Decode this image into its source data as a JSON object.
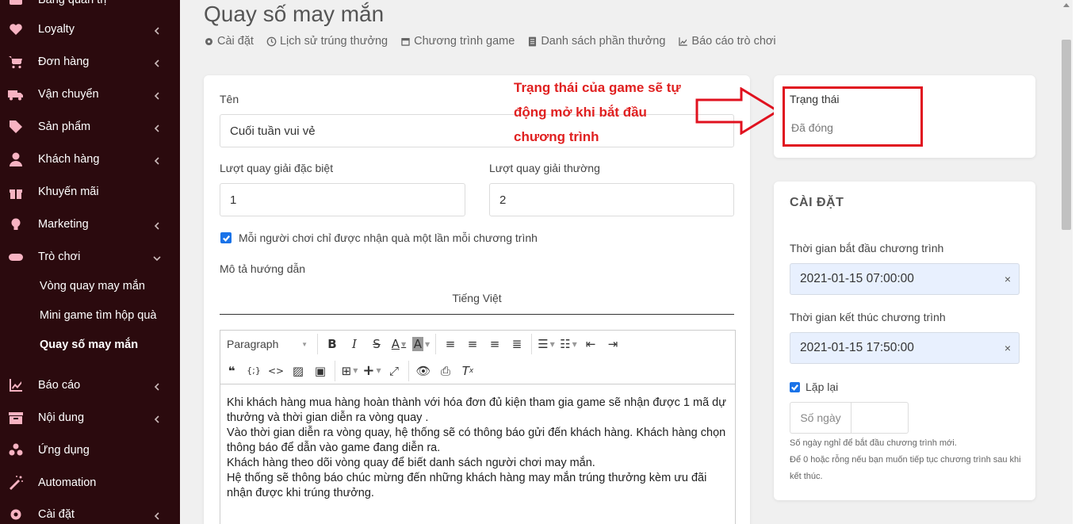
{
  "sidebar": {
    "items": [
      {
        "label": "Bảng quản trị",
        "icon": "dashboard-icon"
      },
      {
        "label": "Loyalty",
        "icon": "heart-icon"
      },
      {
        "label": "Đơn hàng",
        "icon": "cart-icon"
      },
      {
        "label": "Vận chuyển",
        "icon": "truck-icon"
      },
      {
        "label": "Sản phẩm",
        "icon": "tag-icon"
      },
      {
        "label": "Khách hàng",
        "icon": "user-icon"
      },
      {
        "label": "Khuyến mãi",
        "icon": "gift-icon"
      },
      {
        "label": "Marketing",
        "icon": "lightbulb-icon"
      },
      {
        "label": "Trò chơi",
        "icon": "gamepad-icon"
      },
      {
        "label": "Báo cáo",
        "icon": "chart-icon"
      },
      {
        "label": "Nội dung",
        "icon": "archive-icon"
      },
      {
        "label": "Ứng dụng",
        "icon": "apps-icon"
      },
      {
        "label": "Automation",
        "icon": "magic-icon"
      },
      {
        "label": "Cài đặt",
        "icon": "gear-icon"
      }
    ],
    "subitems": [
      {
        "label": "Vòng quay may mắn"
      },
      {
        "label": "Mini game tìm hộp quà"
      },
      {
        "label": "Quay số may mắn"
      }
    ]
  },
  "page": {
    "title": "Quay số may mắn",
    "tabs": [
      {
        "label": "Cài đặt",
        "icon": "gear-icon"
      },
      {
        "label": "Lịch sử trúng thưởng",
        "icon": "history-icon"
      },
      {
        "label": "Chương trình game",
        "icon": "calendar-icon"
      },
      {
        "label": "Danh sách phần thưởng",
        "icon": "list-icon"
      },
      {
        "label": "Báo cáo trò chơi",
        "icon": "chart-icon"
      }
    ]
  },
  "form": {
    "name_label": "Tên",
    "name_value": "Cuối tuần vui vẻ",
    "special_spins_label": "Lượt quay giải đặc biệt",
    "special_spins_value": "1",
    "normal_spins_label": "Lượt quay giải thường",
    "normal_spins_value": "2",
    "once_per_program_label": "Mỗi người chơi chỉ được nhận quà một lần mỗi chương trình",
    "once_per_program_checked": true,
    "description_label": "Mô tả hướng dẫn",
    "language_tab": "Tiếng Việt",
    "paragraph_select": "Paragraph",
    "description_lines": [
      "Khi khách hàng mua hàng hoàn thành với hóa đơn đủ kiện tham gia game sẽ nhận được 1 mã dự thưởng và thời gian diễn ra vòng quay .",
      "Vào thời gian diễn ra vòng quay, hệ thống sẽ có thông báo gửi đến khách hàng. Khách hàng chọn thông báo để dẫn vào game đang diễn ra.",
      "Khách hàng theo dõi vòng quay để biết danh sách người chơi may mắn.",
      "Hệ thống sẽ thông báo chúc mừng đến những khách hàng may mắn trúng thưởng kèm ưu đãi nhận được khi trúng thưởng."
    ]
  },
  "annotation": {
    "text": "Trạng thái của game sẽ tự động mở khi bắt đầu chương trình",
    "color": "#e02020"
  },
  "status": {
    "label": "Trạng thái",
    "value": "Đã đóng"
  },
  "settings": {
    "title": "CÀI ĐẶT",
    "start_label": "Thời gian bắt đầu chương trình",
    "start_value": "2021-01-15 07:00:00",
    "end_label": "Thời gian kết thúc chương trình",
    "end_value": "2021-01-15 17:50:00",
    "clear_symbol": "×",
    "repeat_label": "Lặp lại",
    "repeat_checked": true,
    "days_addon": "Số ngày",
    "days_value": "",
    "help_line1": "Số ngày nghỉ để bắt đầu chương trình mới.",
    "help_line2": "Để 0 hoặc rỗng nếu bạn muốn tiếp tục chương trình sau khi kết thúc."
  },
  "colors": {
    "sidebar_bg": "#2b0a0e",
    "sidebar_icon": "#f7b3c2",
    "accent": "#1a73e8",
    "annotation_red": "#e0121f"
  }
}
